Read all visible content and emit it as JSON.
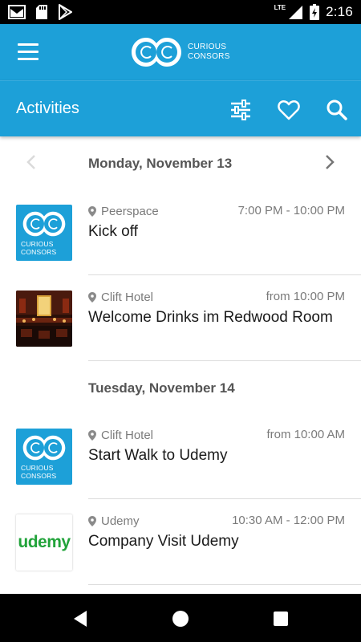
{
  "status_bar": {
    "time": "2:16",
    "network": "LTE",
    "icons": [
      "gmail-icon",
      "sd-card-icon",
      "play-store-icon",
      "signal-icon",
      "battery-icon"
    ]
  },
  "toolbar": {
    "logo_line1": "CURIOUS",
    "logo_line2": "CONSORS",
    "brand_color": "#1da0d8"
  },
  "subheader": {
    "title": "Activities",
    "icons": [
      "filter-icon",
      "heart-icon",
      "search-icon"
    ]
  },
  "sections": [
    {
      "date": "Monday, November 13",
      "items": [
        {
          "location": "Peerspace",
          "time": "7:00 PM - 10:00 PM",
          "title": "Kick off",
          "thumb": "curious-consors-logo",
          "thumb_text1": "CURIOUS",
          "thumb_text2": "CONSORS"
        },
        {
          "location": "Clift Hotel",
          "time": "from 10:00 PM",
          "title": "Welcome Drinks im Redwood Room",
          "thumb": "redwood-room-photo"
        }
      ]
    },
    {
      "date": "Tuesday, November 14",
      "items": [
        {
          "location": "Clift Hotel",
          "time": "from 10:00 AM",
          "title": "Start Walk to Udemy",
          "thumb": "curious-consors-logo",
          "thumb_text1": "CURIOUS",
          "thumb_text2": "CONSORS"
        },
        {
          "location": "Udemy",
          "time": "10:30 AM - 12:00 PM",
          "title": "Company Visit Udemy",
          "thumb": "udemy-logo",
          "thumb_text": "udemy"
        }
      ]
    }
  ],
  "nav_bar": {
    "icons": [
      "back-icon",
      "home-icon",
      "recents-icon"
    ]
  }
}
